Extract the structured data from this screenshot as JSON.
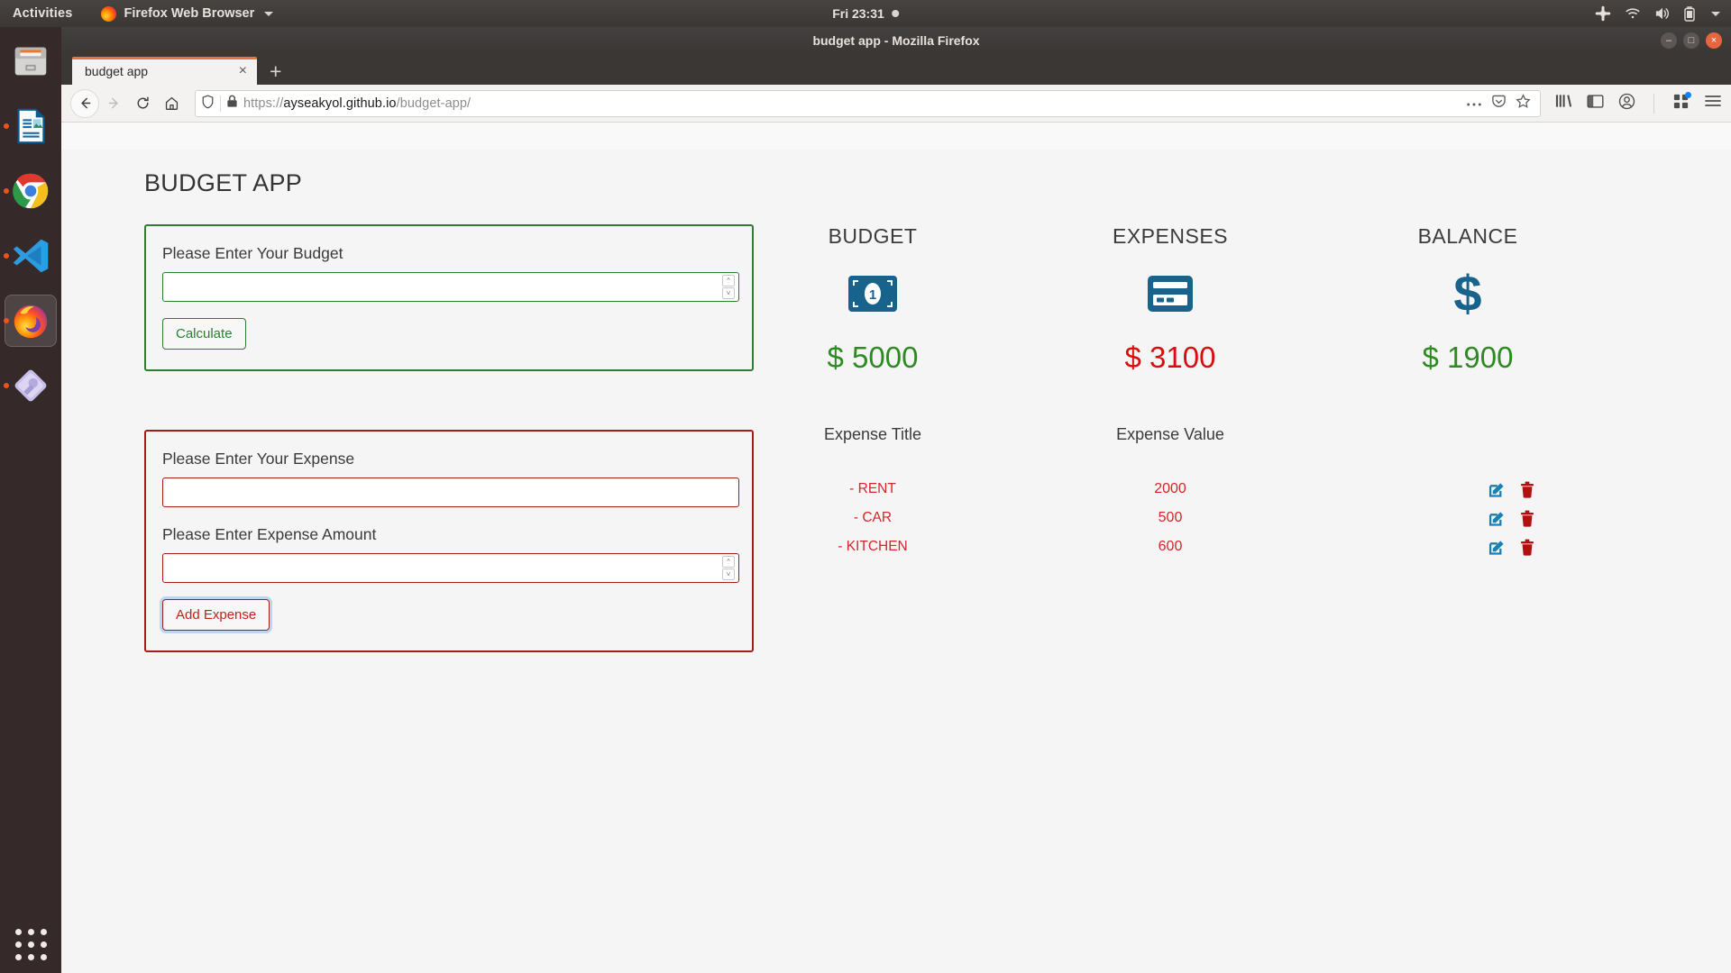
{
  "desktop": {
    "activities": "Activities",
    "app_menu": "Firefox Web Browser",
    "clock": "Fri 23:31",
    "sys_icons": [
      "slack-icon",
      "wifi-icon",
      "volume-icon",
      "battery-icon",
      "chevron-down-icon"
    ],
    "dock_items": [
      {
        "name": "files",
        "running": false
      },
      {
        "name": "libreoffice-writer",
        "running": true
      },
      {
        "name": "google-chrome",
        "running": true
      },
      {
        "name": "visual-studio-code",
        "running": true
      },
      {
        "name": "firefox",
        "running": true,
        "active": true
      },
      {
        "name": "software-updater",
        "running": true
      }
    ],
    "show_apps": "show-applications"
  },
  "browser": {
    "window_title": "budget app - Mozilla Firefox",
    "tab_title": "budget app",
    "tab_close": "×",
    "new_tab": "+",
    "window_controls": {
      "minimize": "–",
      "maximize": "□",
      "close": "×"
    },
    "url_scheme": "https://",
    "url_host": "ayseakyol.github.io",
    "url_path": "/budget-app/",
    "nav": [
      "back-icon",
      "forward-icon",
      "reload-icon",
      "home-icon"
    ],
    "url_left_icons": [
      "tracking-protection-icon",
      "lock-icon"
    ],
    "url_right_icons": [
      "page-actions-icon",
      "pocket-icon",
      "bookmark-star-icon"
    ],
    "toolbar_icons": [
      "library-icon",
      "sidebar-icon",
      "account-icon",
      "extensions-icon",
      "app-menu-icon"
    ]
  },
  "app": {
    "title": "BUDGET APP",
    "budget_form": {
      "label": "Please Enter Your Budget",
      "value": "",
      "placeholder": "",
      "button": "Calculate",
      "accent": "#2e7d32"
    },
    "expense_form": {
      "title_label": "Please Enter Your Expense",
      "title_value": "",
      "title_placeholder": "",
      "amount_label": "Please Enter Expense Amount",
      "amount_value": "",
      "amount_placeholder": "",
      "button": "Add Expense",
      "accent": "#a61b1b"
    },
    "summary": [
      {
        "label": "BUDGET",
        "icon": "money-bill-icon",
        "amount": "$ 5000",
        "color": "green"
      },
      {
        "label": "EXPENSES",
        "icon": "credit-card-icon",
        "amount": "$ 3100",
        "color": "red"
      },
      {
        "label": "BALANCE",
        "icon": "dollar-sign-icon",
        "amount": "$ 1900",
        "color": "green"
      }
    ],
    "table": {
      "header_title": "Expense Title",
      "header_value": "Expense Value",
      "header_actions": "",
      "rows": [
        {
          "title": "- RENT",
          "value": "2000"
        },
        {
          "title": "- CAR",
          "value": "500"
        },
        {
          "title": "- KITCHEN",
          "value": "600"
        }
      ],
      "edit_icon": "edit-icon",
      "delete_icon": "trash-icon"
    },
    "colors": {
      "green": "#2e8b22",
      "red": "#d80e0e",
      "icon_blue": "#17638c",
      "row_red": "#d0272b"
    }
  }
}
